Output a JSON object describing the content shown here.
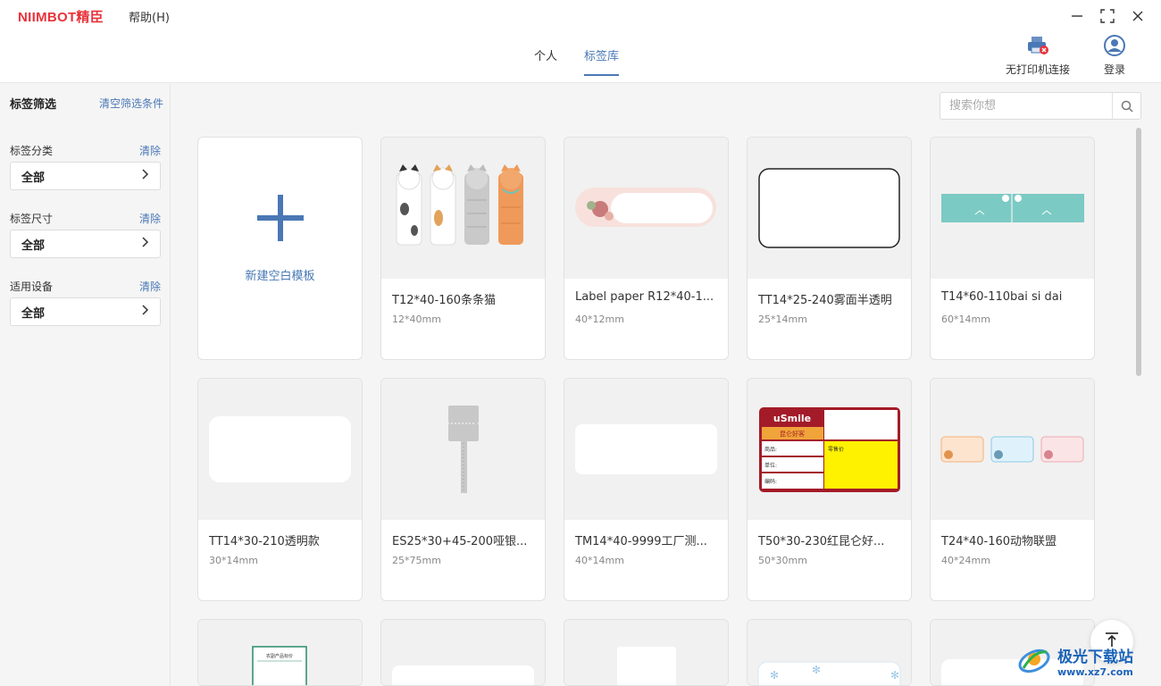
{
  "app": {
    "logo": "NIIMBOT精臣",
    "help_menu": "帮助(H)"
  },
  "header": {
    "tabs": [
      {
        "label": "个人",
        "active": false
      },
      {
        "label": "标签库",
        "active": true
      }
    ],
    "printer": {
      "label": "无打印机连接",
      "icon": "printer-disconnected-icon"
    },
    "login": {
      "label": "登录",
      "icon": "user-avatar-icon"
    }
  },
  "sidebar": {
    "title": "标签筛选",
    "clear_all": "清空筛选条件",
    "filters": [
      {
        "label": "标签分类",
        "clear": "清除",
        "value": "全部"
      },
      {
        "label": "标签尺寸",
        "clear": "清除",
        "value": "全部"
      },
      {
        "label": "适用设备",
        "clear": "清除",
        "value": "全部"
      }
    ]
  },
  "search": {
    "placeholder": "搜索你想"
  },
  "new_template": {
    "label": "新建空白模板"
  },
  "templates": [
    {
      "name": "T12*40-160条条猫",
      "size": "12*40mm"
    },
    {
      "name": "Label paper R12*40-1...",
      "size": "40*12mm"
    },
    {
      "name": "TT14*25-240雾面半透明",
      "size": "25*14mm"
    },
    {
      "name": "T14*60-110bai si dai",
      "size": "60*14mm"
    },
    {
      "name": "TT14*30-210透明款",
      "size": "30*14mm"
    },
    {
      "name": "ES25*30+45-200哑银...",
      "size": "25*75mm"
    },
    {
      "name": "TM14*40-9999工厂测...",
      "size": "40*14mm"
    },
    {
      "name": "T50*30-230红昆仑好...",
      "size": "50*30mm"
    },
    {
      "name": "T24*40-160动物联盟",
      "size": "40*24mm"
    }
  ],
  "thumb_text": {
    "usmile_brand": "uSmile",
    "usmile_sub": "昆仑好客",
    "usmile_row1": "商品:",
    "usmile_row2": "单位:",
    "usmile_row3": "编码:",
    "usmile_price": "零售价",
    "partial_label": "农副产品标价"
  },
  "watermark": {
    "title": "极光下载站",
    "url": "www.xz7.com"
  },
  "colors": {
    "accent": "#4a78b5",
    "brand": "#e8323a"
  }
}
